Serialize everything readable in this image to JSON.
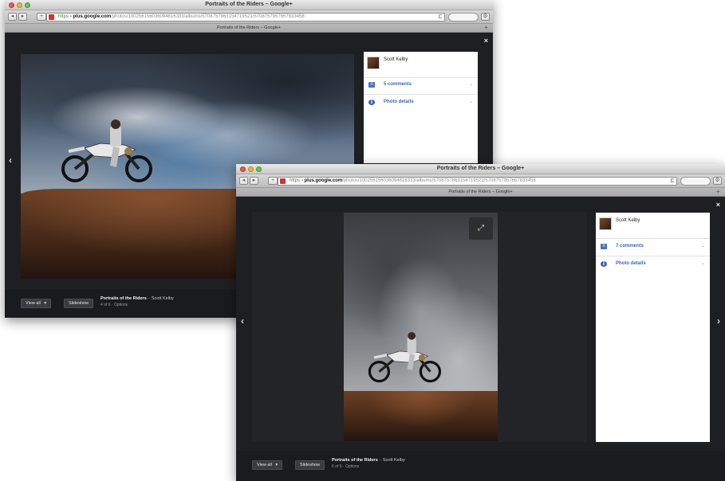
{
  "back_window": {
    "title": "Portraits of the Riders – Google+",
    "url": {
      "scheme": "https",
      "domain": "plus.google.com",
      "path": "/photos/100256156036094816333/albums/5708757863154719521/5708757957657833458"
    },
    "tab_title": "Portraits of the Riders – Google+",
    "author": "Scott Kelby",
    "comments_label": "5 comments",
    "details_label": "Photo details",
    "view_all": "View all",
    "slideshow": "Slideshow",
    "album_title": "Portraits of the Riders",
    "album_author": "Scott Kelby",
    "album_meta": "4 of 6 · Options"
  },
  "front_window": {
    "title": "Portraits of the Riders – Google+",
    "url": {
      "scheme": "https",
      "domain": "plus.google.com",
      "path": "/photos/100256156036094816333/albums/5708757863154719521/5708757957657833458"
    },
    "tab_title": "Portraits of the Riders – Google+",
    "author": "Scott Kelby",
    "comments_label": "7 comments",
    "details_label": "Photo details",
    "view_all": "View all",
    "slideshow": "Slideshow",
    "album_title": "Portraits of the Riders",
    "album_author": "Scott Kelby",
    "album_meta": "6 of 6 · Options"
  },
  "glyphs": {
    "close": "×",
    "prev": "‹",
    "next": "›",
    "back": "◂",
    "forward": "▸",
    "plus": "+",
    "reload": "C",
    "gear": "⚙",
    "expand": "⤢",
    "chevron": "⌄",
    "view_all_caret": "▾",
    "info": "i",
    "comment": "≡",
    "separator": "–"
  },
  "colors": {
    "lightbox_bg": "#1e1f23",
    "link_blue": "#3a67b9",
    "close_red": "#e9584c",
    "minimize_yellow": "#e8b73a",
    "zoom_green": "#6fbf4e"
  }
}
